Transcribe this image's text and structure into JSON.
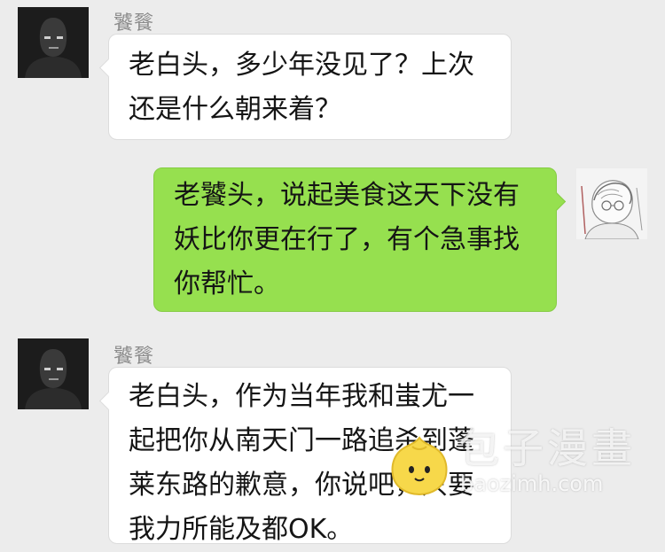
{
  "messages": [
    {
      "direction": "incoming",
      "sender": "饕餮",
      "avatar_icon": "dark-figure-avatar-icon",
      "lines": [
        "老白头，多少年没见了？上次",
        "还是什么朝来着？"
      ]
    },
    {
      "direction": "outgoing",
      "avatar_icon": "sketched-figure-avatar-icon",
      "lines": [
        "老饕头，说起美食这天下没有",
        "妖比你更在行了，有个急事找",
        "你帮忙。"
      ]
    },
    {
      "direction": "incoming",
      "sender": "饕餮",
      "avatar_icon": "dark-figure-avatar-icon",
      "lines": [
        "老白头，作为当年我和蚩尤一",
        "起把你从南天门一路追杀到蓬",
        "莱东路的歉意，你说吧，只要",
        "我力所能及都OK。"
      ]
    }
  ],
  "watermark": {
    "title": "包子漫畫",
    "url": "baozimh.com",
    "logo_icon": "bun-mascot-icon"
  },
  "colors": {
    "background": "#ececec",
    "incoming_bubble": "#ffffff",
    "outgoing_bubble": "#96e04f"
  }
}
